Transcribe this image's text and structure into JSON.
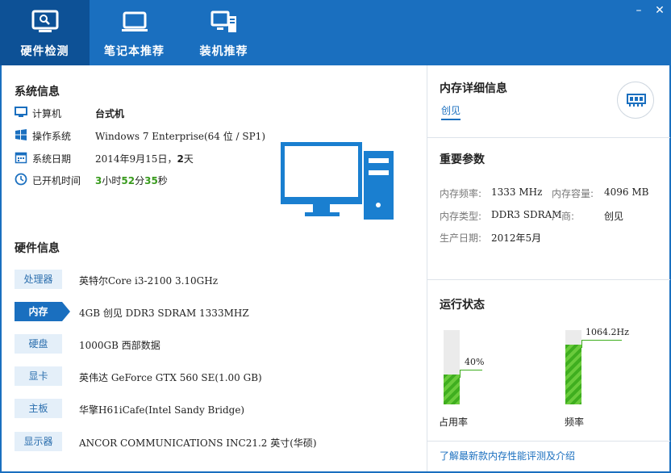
{
  "tabs": [
    {
      "label": "硬件检测",
      "icon": "monitor-search-icon",
      "active": true
    },
    {
      "label": "笔记本推荐",
      "icon": "laptop-icon",
      "active": false
    },
    {
      "label": "装机推荐",
      "icon": "desktop-build-icon",
      "active": false
    }
  ],
  "window": {
    "minimize": "–",
    "close": "✕"
  },
  "system_info": {
    "title": "系统信息",
    "rows": [
      {
        "icon": "computer-icon",
        "label": "计算机",
        "value": "台式机"
      },
      {
        "icon": "windows-logo-icon",
        "label": "操作系统",
        "value": "Windows 7 Enterprise(64 位 / SP1)"
      },
      {
        "icon": "calendar-icon",
        "label": "系统日期",
        "value_prefix": "2014年9月15日，",
        "value_days": "2",
        "value_suffix": "天"
      },
      {
        "icon": "clock-icon",
        "label": "已开机时间",
        "hours": "3",
        "hours_unit": "小时",
        "minutes": "52",
        "minutes_unit": "分",
        "seconds": "35",
        "seconds_unit": "秒"
      }
    ]
  },
  "hardware_info": {
    "title": "硬件信息",
    "rows": [
      {
        "tag": "处理器",
        "value": "英特尔Core i3-2100 3.10GHz",
        "active": false
      },
      {
        "tag": "内存",
        "value": "4GB 创见 DDR3 SDRAM 1333MHZ",
        "active": true
      },
      {
        "tag": "硬盘",
        "value": "1000GB 西部数据",
        "active": false
      },
      {
        "tag": "显卡",
        "value": "英伟达 GeForce GTX 560 SE(1.00 GB)",
        "active": false
      },
      {
        "tag": "主板",
        "value": "华擎H61iCafe(Intel Sandy Bridge)",
        "active": false
      },
      {
        "tag": "显示器",
        "value": "ANCOR COMMUNICATIONS INC21.2 英寸(华硕)",
        "active": false
      }
    ]
  },
  "memory_detail": {
    "title": "内存详细信息",
    "tab": "创见",
    "button_icon": "ram-icon"
  },
  "params": {
    "title": "重要参数",
    "freq_label": "内存频率:",
    "freq_value": "1333 MHz",
    "cap_label": "内存容量:",
    "cap_value": "4096 MB",
    "type_label": "内存类型:",
    "type_value": "DDR3 SDRAM",
    "maker_label": "厂商:",
    "maker_value": "创见",
    "date_label": "生产日期:",
    "date_value": "2012年5月"
  },
  "run_status": {
    "title": "运行状态",
    "usage": {
      "label": "占用率",
      "value_text": "40%",
      "fraction": 0.4
    },
    "freq": {
      "label": "频率",
      "value_text": "1064.2Hz",
      "fraction": 0.8
    }
  },
  "bottom_link": "了解最新款内存性能评测及介绍",
  "colors": {
    "brand": "#1a6fbf",
    "brand_dark": "#0d5196",
    "accent_green": "#3a9b1e"
  }
}
